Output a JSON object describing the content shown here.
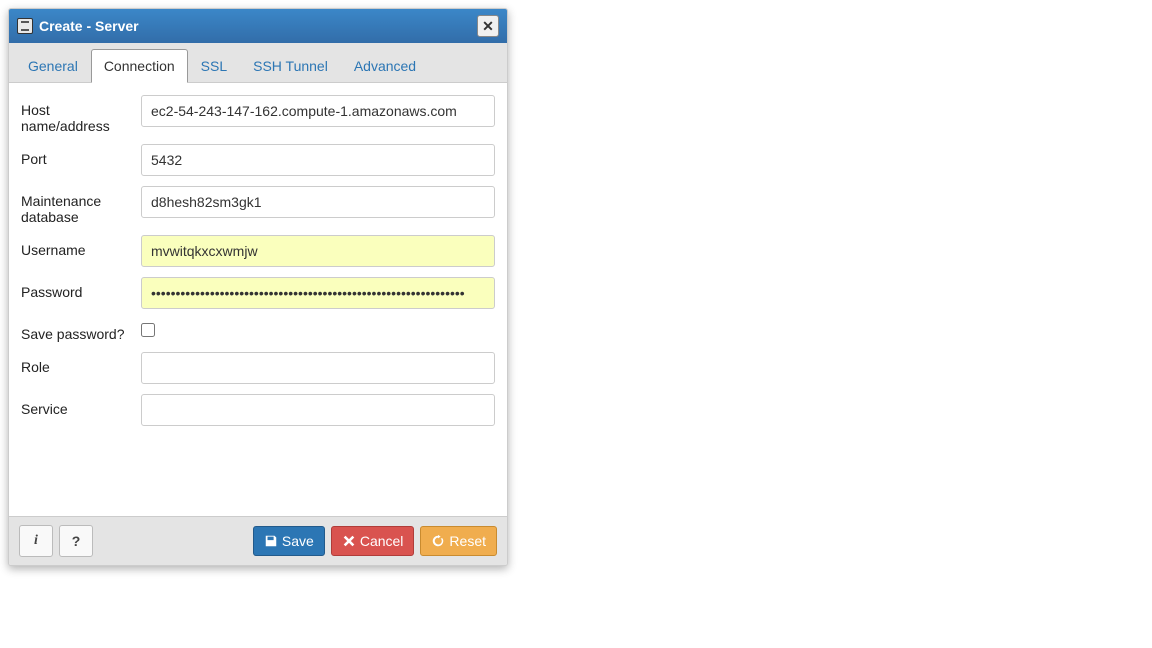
{
  "dialog": {
    "title": "Create - Server"
  },
  "tabs": [
    {
      "label": "General",
      "active": false
    },
    {
      "label": "Connection",
      "active": true
    },
    {
      "label": "SSL",
      "active": false
    },
    {
      "label": "SSH Tunnel",
      "active": false
    },
    {
      "label": "Advanced",
      "active": false
    }
  ],
  "form": {
    "host": {
      "label": "Host name/address",
      "value": "ec2-54-243-147-162.compute-1.amazonaws.com"
    },
    "port": {
      "label": "Port",
      "value": "5432"
    },
    "maintenance_db": {
      "label": "Maintenance database",
      "value": "d8hesh82sm3gk1"
    },
    "username": {
      "label": "Username",
      "value": "mvwitqkxcxwmjw"
    },
    "password": {
      "label": "Password",
      "value": "••••••••••••••••••••••••••••••••••••••••••••••••••••••••••••••••"
    },
    "save_password": {
      "label": "Save password?",
      "checked": false
    },
    "role": {
      "label": "Role",
      "value": ""
    },
    "service": {
      "label": "Service",
      "value": ""
    }
  },
  "footer": {
    "info_label": "i",
    "help_label": "?",
    "save_label": "Save",
    "cancel_label": "Cancel",
    "reset_label": "Reset"
  }
}
